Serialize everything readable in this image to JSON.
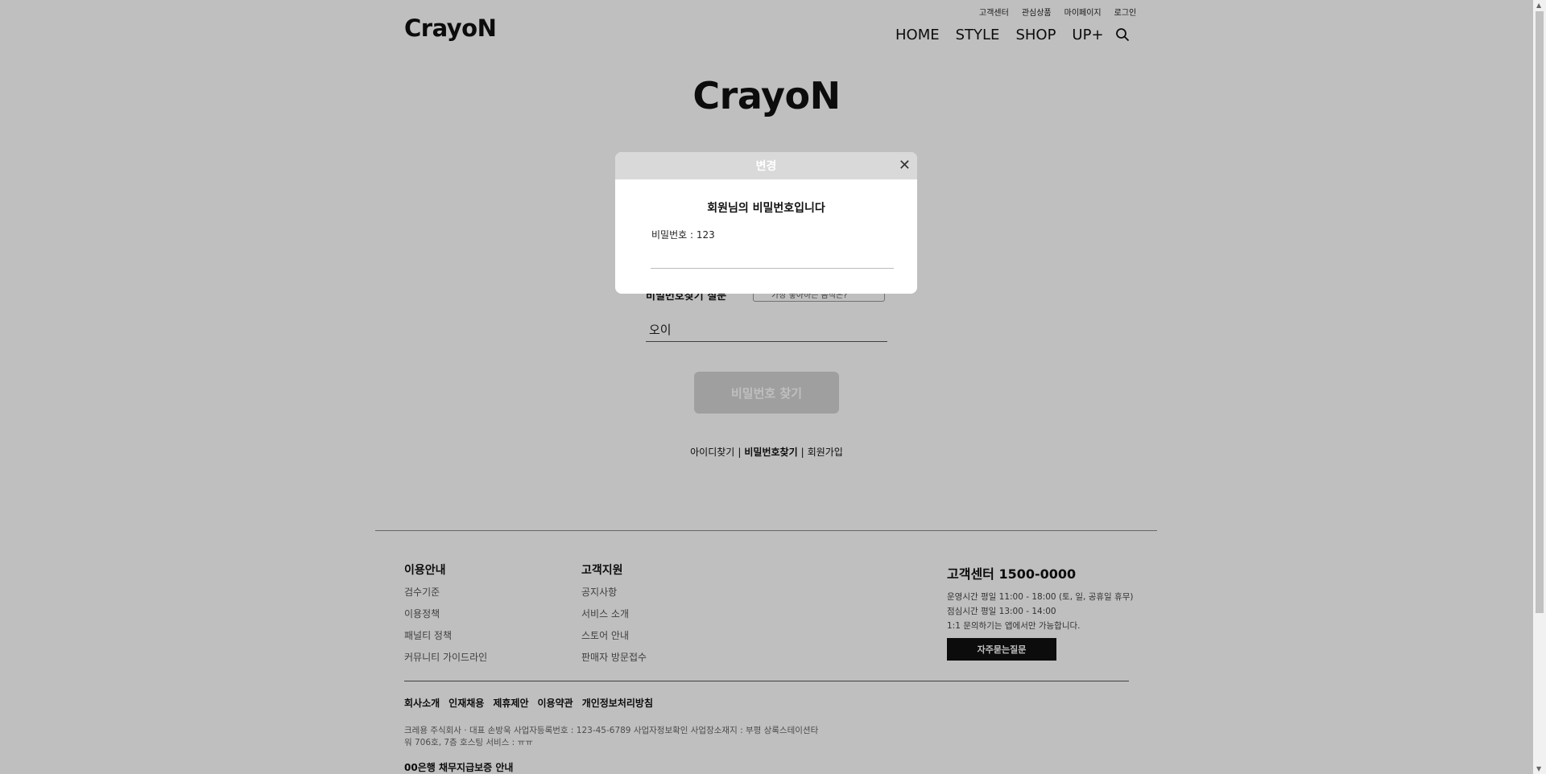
{
  "header": {
    "util_links": [
      "고객센터",
      "관심상품",
      "마이페이지",
      "로그인"
    ],
    "logo": "CrayoN",
    "nav": [
      "HOME",
      "STYLE",
      "SHOP",
      "UP+"
    ],
    "search_icon": "search-icon"
  },
  "main": {
    "logo": "CrayoN",
    "question_label": "비밀번호찾기 질문",
    "question_selected": "가장 좋아하는 음식은?",
    "answer_value": "오이",
    "find_button": "비밀번호 찾기",
    "links": {
      "find_id": "아이디찾기",
      "find_pw": "비밀번호찾기",
      "signup": "회원가입",
      "separator": "|"
    }
  },
  "modal": {
    "title": "변경",
    "heading": "회원님의 비밀번호입니다",
    "password_line": "비밀번호 : 123",
    "close_icon": "close-icon"
  },
  "footer": {
    "guide": {
      "title": "이용안내",
      "items": [
        "검수기준",
        "이용정책",
        "패널티 정책",
        "커뮤니티 가이드라인"
      ]
    },
    "support": {
      "title": "고객지원",
      "items": [
        "공지사항",
        "서비스 소개",
        "스토어 안내",
        "판매자 방문접수"
      ]
    },
    "cs": {
      "title": "고객센터 1500-0000",
      "hours": "운영시간 평일 11:00 - 18:00 (토, 일, 공휴일 휴무)",
      "lunch": "점심시간 평일 13:00 - 14:00",
      "note": "1:1 문의하기는 앱에서만 가능합니다.",
      "faq_button": "자주묻는질문"
    },
    "policy_links": [
      "회사소개",
      "인재채용",
      "제휴제안",
      "이용약관",
      "개인정보처리방침"
    ],
    "company_info_1": "크레용 주식회사 · 대표 손방욱    사업자등록번호 : 123-45-6789    사업자정보확인    사업장소재지 : 부평 상록스테이션타",
    "company_info_2": "워 706호, 7층    호스팅 서비스 : ㅠㅠ",
    "escrow": "00은행 채무지급보증 안내"
  }
}
